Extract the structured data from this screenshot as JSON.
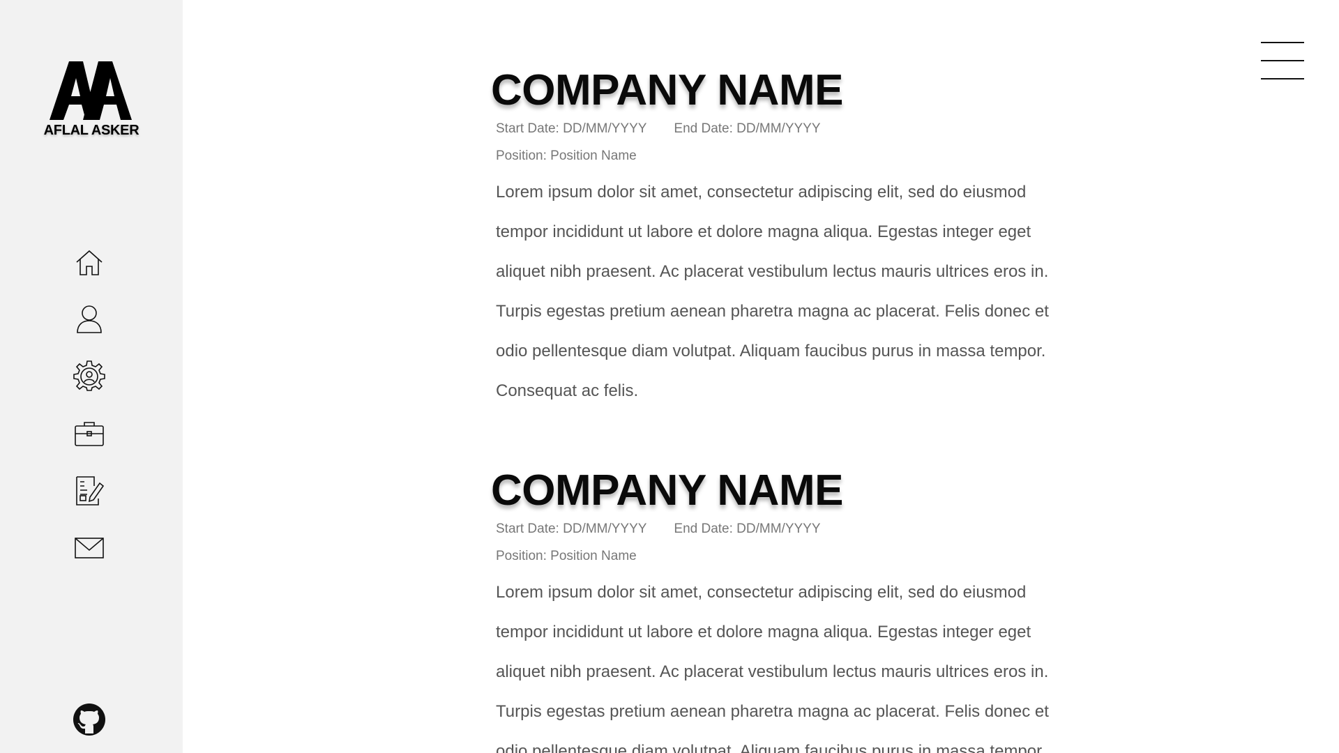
{
  "brand": {
    "monogram": "AA",
    "name": "AFLAL ASKER"
  },
  "nav": {
    "items": [
      {
        "icon": "home-icon"
      },
      {
        "icon": "user-icon"
      },
      {
        "icon": "gear-icon"
      },
      {
        "icon": "briefcase-icon"
      },
      {
        "icon": "document-edit-icon"
      },
      {
        "icon": "mail-icon"
      }
    ],
    "footer_icon": "github-icon"
  },
  "menu_icon": "hamburger-menu-icon",
  "entries": [
    {
      "company": "COMPANY NAME",
      "start_date": "Start Date: DD/MM/YYYY",
      "end_date": "End Date: DD/MM/YYYY",
      "position": "Position: Position Name",
      "description_lines": [
        "Lorem ipsum dolor sit amet, consectetur adipiscing elit, sed do eiusmod",
        " tempor incididunt ut labore et dolore magna aliqua. Egestas integer eget",
        " aliquet nibh praesent. Ac placerat vestibulum lectus mauris ultrices eros in.",
        "Turpis egestas pretium aenean pharetra magna ac placerat. Felis donec et",
        "odio pellentesque diam volutpat. Aliquam faucibus purus in massa tempor.",
        "Consequat ac felis."
      ]
    },
    {
      "company": "COMPANY NAME",
      "start_date": "Start Date: DD/MM/YYYY",
      "end_date": "End Date: DD/MM/YYYY",
      "position": "Position: Position Name",
      "description_lines": [
        "Lorem ipsum dolor sit amet, consectetur adipiscing elit, sed do eiusmod",
        " tempor incididunt ut labore et dolore magna aliqua. Egestas integer eget",
        " aliquet nibh praesent. Ac placerat vestibulum lectus mauris ultrices eros in.",
        "Turpis egestas pretium aenean pharetra magna ac placerat. Felis donec et",
        "odio pellentesque diam volutpat. Aliquam faucibus purus in massa tempor."
      ]
    }
  ]
}
